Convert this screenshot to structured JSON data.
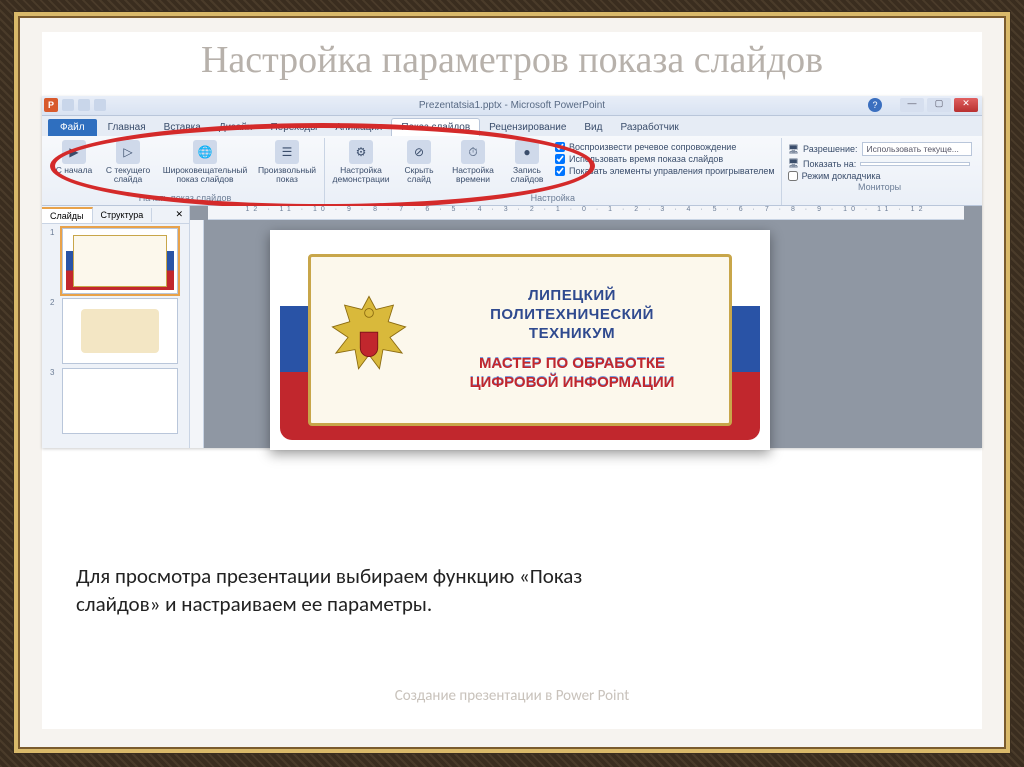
{
  "slide": {
    "title": "Настройка параметров показа слайдов",
    "body": "Для просмотра презентации выбираем функцию «Показ слайдов» и настраиваем ее параметры.",
    "footer": "Создание презентации в Power Point"
  },
  "app": {
    "title": "Prezentatsia1.pptx - Microsoft PowerPoint",
    "tabs": {
      "file": "Файл",
      "home": "Главная",
      "insert": "Вставка",
      "design": "Дизайн",
      "transitions": "Переходы",
      "animation": "Анимация",
      "slideshow": "Показ слайдов",
      "review": "Рецензирование",
      "view": "Вид",
      "developer": "Разработчик"
    },
    "ribbon": {
      "start_group": "Начать показ слайдов",
      "from_beginning": "С начала",
      "from_current": "С текущего слайда",
      "broadcast": "Широковещательный показ слайдов",
      "custom": "Произвольный показ",
      "setup_group": "Настройка",
      "setup_show": "Настройка демонстрации",
      "hide_slide": "Скрыть слайд",
      "rehearse": "Настройка времени",
      "record": "Запись слайдов",
      "chk_narration": "Воспроизвести речевое сопровождение",
      "chk_timings": "Использовать время показа слайдов",
      "chk_controls": "Показать элементы управления проигрывателем",
      "monitors_group": "Мониторы",
      "resolution_label": "Разрешение:",
      "resolution_value": "Использовать текуще...",
      "show_on_label": "Показать на:",
      "presenter_view": "Режим докладчика"
    },
    "panel": {
      "slides_tab": "Слайды",
      "outline_tab": "Структура"
    },
    "ruler": "12 · 11 · 10 · 9 · 8 · 7 · 6 · 5 · 4 · 3 · 2 · 1 · 0 · 1 · 2 · 3 · 4 · 5 · 6 · 7 · 8 · 9 · 10 · 11 · 12",
    "busy_slide": {
      "line1": "ЛИПЕЦКИЙ",
      "line2": "ПОЛИТЕХНИЧЕСКИЙ",
      "line3": "ТЕХНИКУМ",
      "line4": "МАСТЕР ПО ОБРАБОТКЕ",
      "line5": "ЦИФРОВОЙ ИНФОРМАЦИИ"
    }
  }
}
